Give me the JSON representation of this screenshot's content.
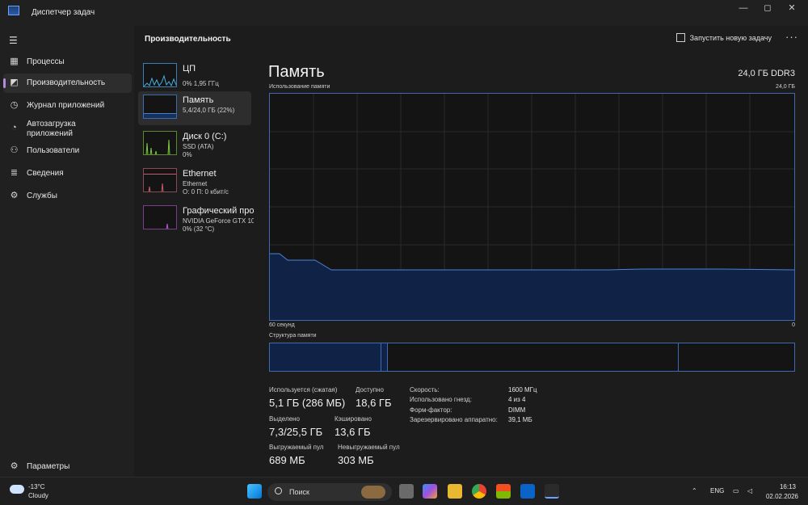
{
  "window": {
    "title": "Диспетчер задач",
    "controls": {
      "minimize": "—",
      "maximize": "◻",
      "close": "✕"
    }
  },
  "nav": {
    "items": [
      {
        "label": "Процессы",
        "icon": "processes-icon"
      },
      {
        "label": "Производительность",
        "icon": "performance-icon",
        "active": true
      },
      {
        "label": "Журнал приложений",
        "icon": "app-history-icon"
      },
      {
        "label": "Автозагрузка приложений",
        "icon": "startup-icon"
      },
      {
        "label": "Пользователи",
        "icon": "users-icon"
      },
      {
        "label": "Сведения",
        "icon": "details-icon"
      },
      {
        "label": "Службы",
        "icon": "services-icon"
      }
    ],
    "settings_label": "Параметры"
  },
  "header": {
    "title": "Производительность",
    "run_task_label": "Запустить новую задачу",
    "more": "···"
  },
  "devices": [
    {
      "name": "ЦП",
      "sub1": "0% 1,95 ГГц",
      "sub2": ""
    },
    {
      "name": "Память",
      "sub1": "5,4/24,0 ГБ (22%)",
      "sub2": ""
    },
    {
      "name": "Диск 0 (C:)",
      "sub1": "SSD (ATA)",
      "sub2": "0%"
    },
    {
      "name": "Ethernet",
      "sub1": "Ethernet",
      "sub2": "О: 0 П: 0 кбит/с"
    },
    {
      "name": "Графический про",
      "sub1": "NVIDIA GeForce GTX 10",
      "sub2": "0% (32 °C)"
    }
  ],
  "memory": {
    "title": "Память",
    "total_type": "24,0 ГБ DDR3",
    "usage_label": "Использование памяти",
    "usage_max": "24,0 ГБ",
    "time_label": "60 секунд",
    "time_zero": "0",
    "usage_fraction": 0.22,
    "composition_label": "Структура памяти",
    "composition": {
      "in_use": 0.213,
      "modified": 0.012,
      "standby": 0.567,
      "free": 0.208
    },
    "stats": {
      "in_use_label": "Используется (сжатая)",
      "in_use_value": "5,1 ГБ (286 МБ)",
      "available_label": "Доступно",
      "available_value": "18,6 ГБ",
      "committed_label": "Выделено",
      "committed_value": "7,3/25,5 ГБ",
      "cached_label": "Кэшировано",
      "cached_value": "13,6 ГБ",
      "paged_label": "Выгружаемый пул",
      "paged_value": "689 МБ",
      "nonpaged_label": "Невыгружаемый пул",
      "nonpaged_value": "303 МБ"
    },
    "details": [
      {
        "label": "Скорость:",
        "value": "1600 МГц"
      },
      {
        "label": "Использовано гнезд:",
        "value": "4 из 4"
      },
      {
        "label": "Форм-фактор:",
        "value": "DIMM"
      },
      {
        "label": "Зарезервировано аппаратно:",
        "value": "39,1 МБ"
      }
    ]
  },
  "taskbar": {
    "temperature": "-13°C",
    "weather": "Cloudy",
    "search_label": "Поиск",
    "language": "ENG",
    "time": "16:13",
    "date": "02.02.2026"
  }
}
